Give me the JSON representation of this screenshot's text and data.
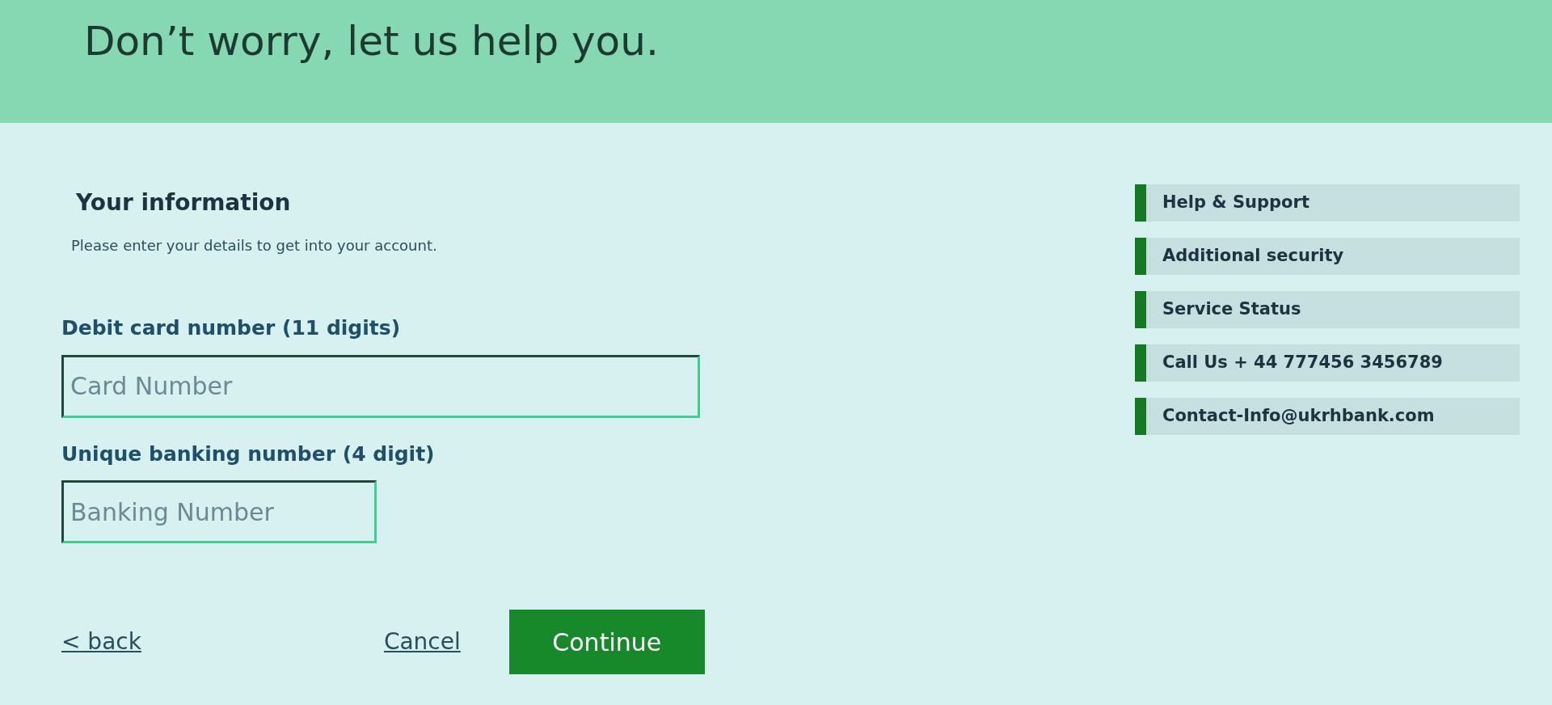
{
  "header": {
    "title": "Don’t worry, let us help you."
  },
  "form": {
    "title": "Your information",
    "subtitle": "Please enter your details to get into your account.",
    "fields": [
      {
        "label": "Debit card number (11 digits)",
        "placeholder": "Card Number",
        "wide": true
      },
      {
        "label": "Unique banking number (4 digit)",
        "placeholder": "Banking Number",
        "wide": false
      }
    ],
    "back": "< back",
    "cancel": "Cancel",
    "continue": "Continue"
  },
  "sidebar": {
    "items": [
      {
        "label": "Help & Support"
      },
      {
        "label": "Additional security"
      },
      {
        "label": "Service Status"
      },
      {
        "label": "Call Us + 44 777456 3456789"
      },
      {
        "label": "Contact-Info@ukrhbank.com"
      }
    ]
  }
}
